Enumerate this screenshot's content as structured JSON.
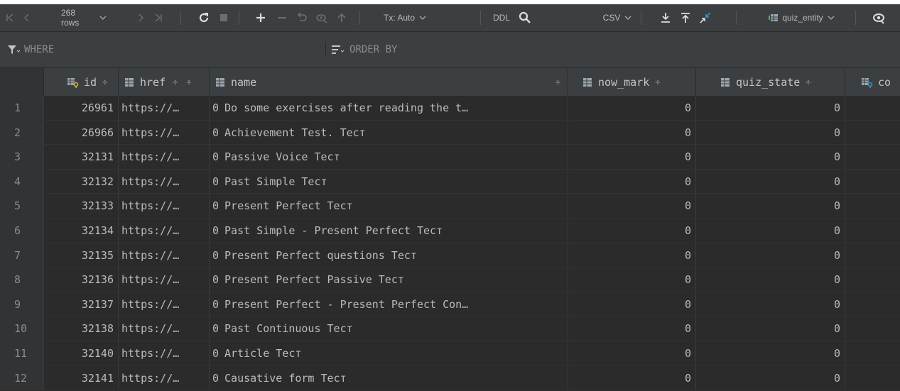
{
  "toolbar": {
    "rows_label": "268 rows",
    "tx_label": "Tx: Auto",
    "ddl_label": "DDL",
    "csv_label": "CSV",
    "table_selector": "quiz_entity",
    "icons": [
      "first-page-icon",
      "prev-page-icon",
      "dropdown-icon",
      "next-page-icon",
      "last-page-icon",
      "refresh-icon",
      "stop-icon",
      "add-row-icon",
      "delete-row-icon",
      "revert-icon",
      "preview-icon",
      "submit-icon",
      "search-icon",
      "download-icon",
      "upload-icon",
      "compare-icon",
      "table-icon",
      "eye-icon"
    ]
  },
  "filter": {
    "where_label": "WHERE",
    "order_label": "ORDER BY"
  },
  "columns": [
    {
      "name": "id",
      "icon": "key-column-icon"
    },
    {
      "name": "href",
      "icon": "column-icon"
    },
    {
      "name": "name",
      "icon": "column-icon"
    },
    {
      "name": "now_mark",
      "icon": "column-icon"
    },
    {
      "name": "quiz_state",
      "icon": "column-icon"
    },
    {
      "name": "co",
      "icon": "key-column-icon"
    }
  ],
  "sort_glyph": "÷",
  "rows": [
    {
      "n": "1",
      "id": "26961",
      "href": "https://…",
      "z": "0",
      "name": "Do some exercises after reading the t…",
      "now_mark": "0",
      "quiz_state": "0"
    },
    {
      "n": "2",
      "id": "26966",
      "href": "https://…",
      "z": "0",
      "name": "Achievement Test. Тест",
      "now_mark": "0",
      "quiz_state": "0"
    },
    {
      "n": "3",
      "id": "32131",
      "href": "https://…",
      "z": "0",
      "name": "Passive Voice Тест",
      "now_mark": "0",
      "quiz_state": "0"
    },
    {
      "n": "4",
      "id": "32132",
      "href": "https://…",
      "z": "0",
      "name": "Past Simple Тест",
      "now_mark": "0",
      "quiz_state": "0"
    },
    {
      "n": "5",
      "id": "32133",
      "href": "https://…",
      "z": "0",
      "name": "Present Perfect Тест",
      "now_mark": "0",
      "quiz_state": "0"
    },
    {
      "n": "6",
      "id": "32134",
      "href": "https://…",
      "z": "0",
      "name": "Past Simple - Present Perfect Тест",
      "now_mark": "0",
      "quiz_state": "0"
    },
    {
      "n": "7",
      "id": "32135",
      "href": "https://…",
      "z": "0",
      "name": "Present Perfect questions Тест",
      "now_mark": "0",
      "quiz_state": "0"
    },
    {
      "n": "8",
      "id": "32136",
      "href": "https://…",
      "z": "0",
      "name": "Present Perfect Passive Тест",
      "now_mark": "0",
      "quiz_state": "0"
    },
    {
      "n": "9",
      "id": "32137",
      "href": "https://…",
      "z": "0",
      "name": "Present Perfect - Present Perfect Con…",
      "now_mark": "0",
      "quiz_state": "0"
    },
    {
      "n": "10",
      "id": "32138",
      "href": "https://…",
      "z": "0",
      "name": "Past Continuous Тест",
      "now_mark": "0",
      "quiz_state": "0"
    },
    {
      "n": "11",
      "id": "32140",
      "href": "https://…",
      "z": "0",
      "name": "Article Тест",
      "now_mark": "0",
      "quiz_state": "0"
    },
    {
      "n": "12",
      "id": "32141",
      "href": "https://…",
      "z": "0",
      "name": "Causative form Тест",
      "now_mark": "0",
      "quiz_state": "0"
    }
  ],
  "colors": {
    "background": "#2b2b2b",
    "toolbar": "#3c3f41",
    "key_icon": "#d4a93f",
    "column_icon": "#9aa7b0",
    "refresh": "#dddddd"
  }
}
